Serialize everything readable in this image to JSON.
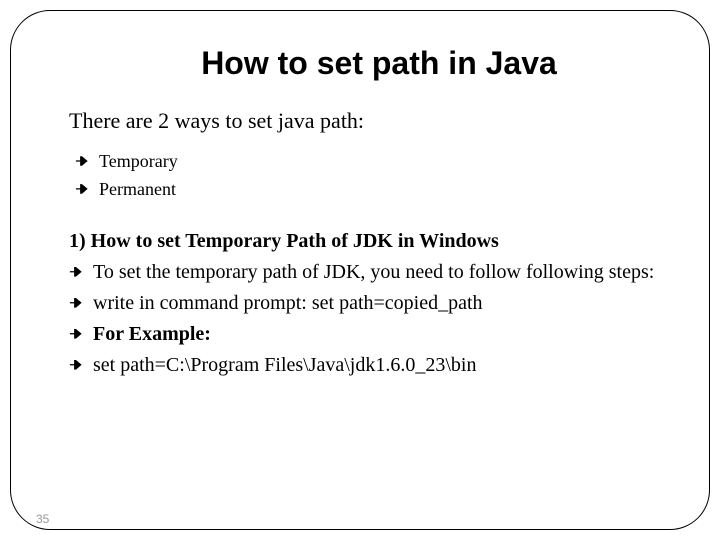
{
  "title": "How to set path in Java",
  "intro": "There are 2 ways to set java path:",
  "ways": [
    "Temporary",
    "Permanent"
  ],
  "section1": {
    "heading": "1) How to set Temporary Path of JDK in Windows",
    "items": [
      {
        "text": "To set the temporary path of JDK, you need to follow following steps:",
        "bold": false
      },
      {
        "text": "write in command prompt: set path=copied_path",
        "bold": false
      },
      {
        "text": "For Example:",
        "bold": true
      },
      {
        "text": "set path=C:\\Program Files\\Java\\jdk1.6.0_23\\bin",
        "bold": false
      }
    ]
  },
  "page_number": "35"
}
